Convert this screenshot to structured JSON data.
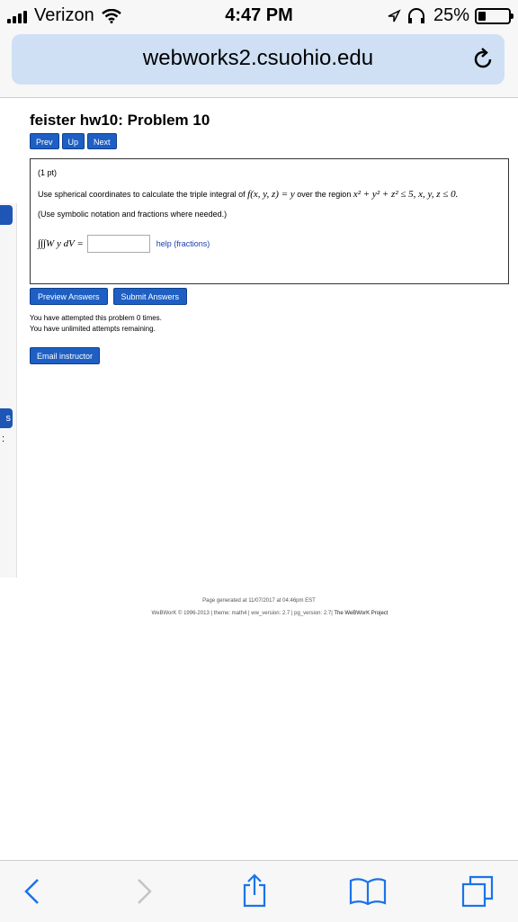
{
  "status": {
    "carrier": "Verizon",
    "time": "4:47 PM",
    "battery_percent": "25%",
    "battery_level": 0.25
  },
  "browser": {
    "url": "webworks2.csuohio.edu"
  },
  "page": {
    "title": "feister hw10: Problem 10",
    "nav": {
      "prev": "Prev",
      "up": "Up",
      "next": "Next"
    },
    "problem": {
      "points": "(1 pt)",
      "question_prefix": "Use spherical coordinates to calculate the triple integral of ",
      "function_expr": "f(x, y, z) = y",
      "question_mid": " over the region ",
      "region_expr": "x² + y² + z² ≤ 5,  x, y, z ≤ 0.",
      "note": "(Use symbolic notation and fractions where needed.)",
      "integral_expr": "∫∫∫W y dV =",
      "answer_value": "",
      "help_link": "help (fractions)"
    },
    "actions": {
      "preview": "Preview Answers",
      "submit": "Submit Answers"
    },
    "attempts_line1": "You have attempted this problem 0 times.",
    "attempts_line2": "You have unlimited attempts remaining.",
    "email_button": "Email instructor",
    "footer_generated": "Page generated at 11/07/2017 at 04:46pm EST",
    "footer_copyright": "WeBWorK © 1996-2013 | theme: math4 | ww_version: 2.7 | pg_version: 2.7|",
    "footer_project": "The WeBWorK Project"
  },
  "sidebar_fragment": {
    "button_letter": "s",
    "colon": ":"
  },
  "colors": {
    "accent": "#1e5fc4",
    "urlbar": "#cfe0f5",
    "toolbar_icon": "#1a73e8"
  }
}
